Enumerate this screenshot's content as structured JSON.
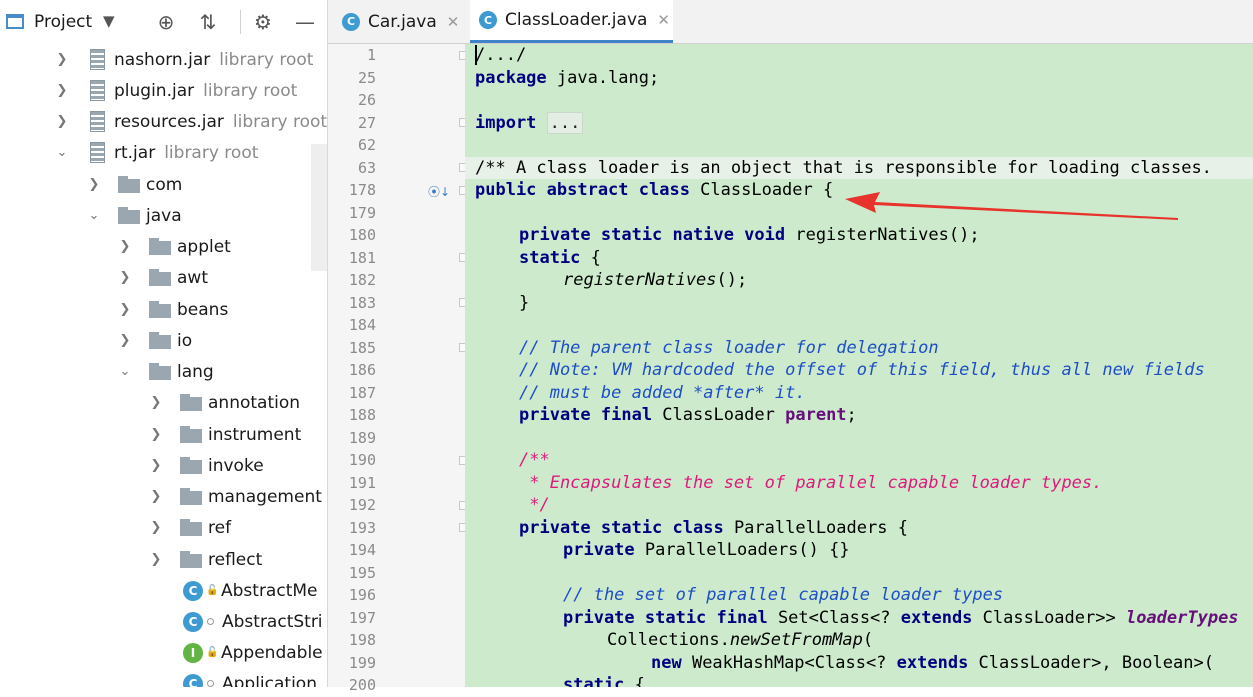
{
  "project_panel": {
    "title": "Project",
    "tree": [
      {
        "id": "nashorn",
        "label": "nashorn.jar",
        "sub": "library root",
        "kind": "jar",
        "state": "collapsed"
      },
      {
        "id": "plugin",
        "label": "plugin.jar",
        "sub": "library root",
        "kind": "jar",
        "state": "collapsed"
      },
      {
        "id": "resources",
        "label": "resources.jar",
        "sub": "library root",
        "kind": "jar",
        "state": "collapsed"
      },
      {
        "id": "rt",
        "label": "rt.jar",
        "sub": "library root",
        "kind": "jar",
        "state": "expanded"
      },
      {
        "id": "com",
        "label": "com",
        "kind": "folder",
        "state": "collapsed"
      },
      {
        "id": "java",
        "label": "java",
        "kind": "folder",
        "state": "expanded"
      },
      {
        "id": "applet",
        "label": "applet",
        "kind": "folder",
        "state": "collapsed"
      },
      {
        "id": "awt",
        "label": "awt",
        "kind": "folder",
        "state": "collapsed"
      },
      {
        "id": "beans",
        "label": "beans",
        "kind": "folder",
        "state": "collapsed"
      },
      {
        "id": "io",
        "label": "io",
        "kind": "folder",
        "state": "collapsed"
      },
      {
        "id": "lang",
        "label": "lang",
        "kind": "folder",
        "state": "expanded"
      },
      {
        "id": "annotation",
        "label": "annotation",
        "kind": "folder",
        "state": "collapsed"
      },
      {
        "id": "instrument",
        "label": "instrument",
        "kind": "folder",
        "state": "collapsed"
      },
      {
        "id": "invoke",
        "label": "invoke",
        "kind": "folder",
        "state": "collapsed"
      },
      {
        "id": "management",
        "label": "management",
        "kind": "folder",
        "state": "collapsed"
      },
      {
        "id": "ref",
        "label": "ref",
        "kind": "folder",
        "state": "collapsed"
      },
      {
        "id": "reflect",
        "label": "reflect",
        "kind": "folder",
        "state": "collapsed"
      },
      {
        "id": "abstractme",
        "label": "AbstractMe",
        "kind": "class",
        "badge": "C"
      },
      {
        "id": "abstractstri",
        "label": "AbstractStri",
        "kind": "class",
        "badge": "C"
      },
      {
        "id": "appendable",
        "label": "Appendable",
        "kind": "interface",
        "badge": "I"
      },
      {
        "id": "application",
        "label": "Application",
        "kind": "class",
        "badge": "C"
      }
    ]
  },
  "tabs": [
    {
      "label": "Car.java",
      "badge": "C",
      "active": false
    },
    {
      "label": "ClassLoader.java",
      "badge": "C",
      "active": true
    }
  ],
  "line_numbers": [
    "1",
    "25",
    "26",
    "27",
    "62",
    "63",
    "178",
    "179",
    "180",
    "181",
    "182",
    "183",
    "184",
    "185",
    "186",
    "187",
    "188",
    "189",
    "190",
    "191",
    "192",
    "193",
    "194",
    "195",
    "196",
    "197",
    "198",
    "199",
    "200"
  ],
  "code": {
    "l1": "/.../",
    "l25_kw": "package",
    "l25_rest": " java.lang;",
    "l27_kw": "import",
    "l27_fold": "...",
    "l63": "/** A class loader is an object that is responsible for loading classes.",
    "l178_kw": "public abstract class",
    "l178_rest": " ClassLoader {",
    "l180_kw": "private static native void",
    "l180_rest": " registerNatives();",
    "l181_kw": "static",
    "l181_rest": " {",
    "l182": "registerNatives",
    "l182_rest": "();",
    "l183": "}",
    "l185": "// The parent class loader for delegation",
    "l186": "// Note: VM hardcoded the offset of this field, thus all new fields",
    "l187": "// must be added *after* it.",
    "l188_kw": "private final",
    "l188_type": " ClassLoader ",
    "l188_fld": "parent",
    "l188_end": ";",
    "l190": "/**",
    "l191": " * Encapsulates the set of parallel capable loader types.",
    "l192": " */",
    "l193_kw": "private static class",
    "l193_rest": " ParallelLoaders {",
    "l194_kw": "private",
    "l194_rest": " ParallelLoaders() {}",
    "l196": "// the set of parallel capable loader types",
    "l197_kw": "private static final",
    "l197_a": " Set<Class<? ",
    "l197_kw2": "extends",
    "l197_b": " ClassLoader>> ",
    "l197_fld": "loaderTypes",
    "l198_a": "Collections.",
    "l198_it": "newSetFromMap",
    "l198_b": "(",
    "l199_kw": "new",
    "l199_a": " WeakHashMap<Class<? ",
    "l199_kw2": "extends",
    "l199_b": " ClassLoader>, Boolean>(",
    "l200_kw": "static",
    "l200_rest": " {"
  },
  "colors": {
    "code_background": "#cdebcc",
    "annotation_arrow": "#e8322c",
    "keyword": "#000080",
    "comment": "#1e4ec7",
    "doc_comment": "#e0197d",
    "field": "#660e7a"
  }
}
